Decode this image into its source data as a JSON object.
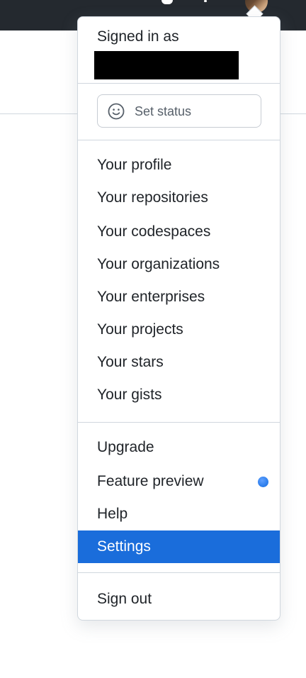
{
  "header": {
    "signed_in_label": "Signed in as"
  },
  "status": {
    "label": "Set status"
  },
  "menu": {
    "profile": "Your profile",
    "repositories": "Your repositories",
    "codespaces": "Your codespaces",
    "organizations": "Your organizations",
    "enterprises": "Your enterprises",
    "projects": "Your projects",
    "stars": "Your stars",
    "gists": "Your gists",
    "upgrade": "Upgrade",
    "feature_preview": "Feature preview",
    "help": "Help",
    "settings": "Settings",
    "sign_out": "Sign out"
  },
  "colors": {
    "active_item_bg": "#1a6ddb",
    "feature_dot": "#2f80ed",
    "topbar": "#24292f"
  },
  "icons": {
    "status": "smiley-icon",
    "feature_preview_indicator": "blue-dot-indicator"
  }
}
